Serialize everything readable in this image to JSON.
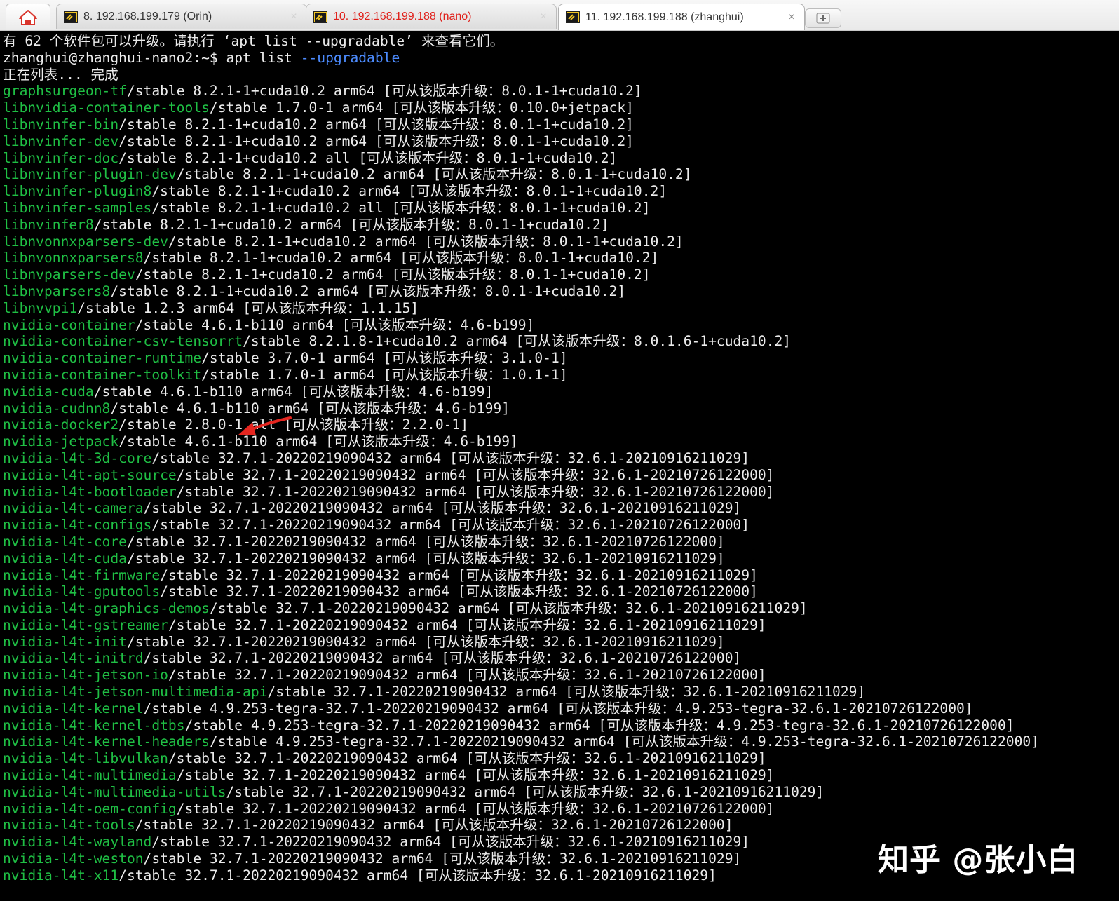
{
  "tabs": {
    "home_icon": "home-icon",
    "items": [
      {
        "label": "8. 192.168.199.179 (Orin)",
        "icon": "terminal-icon",
        "close": "×"
      },
      {
        "label": "10. 192.168.199.188 (nano)",
        "icon": "terminal-icon",
        "close": "×"
      },
      {
        "label": "11. 192.168.199.188 (zhanghui)",
        "icon": "terminal-icon",
        "close": "×"
      }
    ],
    "new_tab_icon": "new-tab-icon"
  },
  "colors": {
    "package_name": "#1fbf44",
    "option_flag": "#4d8cff",
    "text": "#ececec",
    "warning_tab": "#e0201a"
  },
  "terminal": {
    "notice": "有 62 个软件包可以升级。请执行 ‘apt list --upgradable’ 来查看它们。",
    "prompt": "zhanghui@zhanghui-nano2:~$ ",
    "command": "apt list ",
    "command_flag": "--upgradable",
    "listing_status": "正在列表... 完成",
    "packages": [
      {
        "name": "graphsurgeon-tf",
        "rest": "/stable 8.2.1-1+cuda10.2 arm64 [可从该版本升级：8.0.1-1+cuda10.2]"
      },
      {
        "name": "libnvidia-container-tools",
        "rest": "/stable 1.7.0-1 arm64 [可从该版本升级：0.10.0+jetpack]"
      },
      {
        "name": "libnvinfer-bin",
        "rest": "/stable 8.2.1-1+cuda10.2 arm64 [可从该版本升级：8.0.1-1+cuda10.2]"
      },
      {
        "name": "libnvinfer-dev",
        "rest": "/stable 8.2.1-1+cuda10.2 arm64 [可从该版本升级：8.0.1-1+cuda10.2]"
      },
      {
        "name": "libnvinfer-doc",
        "rest": "/stable 8.2.1-1+cuda10.2 all [可从该版本升级：8.0.1-1+cuda10.2]"
      },
      {
        "name": "libnvinfer-plugin-dev",
        "rest": "/stable 8.2.1-1+cuda10.2 arm64 [可从该版本升级：8.0.1-1+cuda10.2]"
      },
      {
        "name": "libnvinfer-plugin8",
        "rest": "/stable 8.2.1-1+cuda10.2 arm64 [可从该版本升级：8.0.1-1+cuda10.2]"
      },
      {
        "name": "libnvinfer-samples",
        "rest": "/stable 8.2.1-1+cuda10.2 all [可从该版本升级：8.0.1-1+cuda10.2]"
      },
      {
        "name": "libnvinfer8",
        "rest": "/stable 8.2.1-1+cuda10.2 arm64 [可从该版本升级：8.0.1-1+cuda10.2]"
      },
      {
        "name": "libnvonnxparsers-dev",
        "rest": "/stable 8.2.1-1+cuda10.2 arm64 [可从该版本升级：8.0.1-1+cuda10.2]"
      },
      {
        "name": "libnvonnxparsers8",
        "rest": "/stable 8.2.1-1+cuda10.2 arm64 [可从该版本升级：8.0.1-1+cuda10.2]"
      },
      {
        "name": "libnvparsers-dev",
        "rest": "/stable 8.2.1-1+cuda10.2 arm64 [可从该版本升级：8.0.1-1+cuda10.2]"
      },
      {
        "name": "libnvparsers8",
        "rest": "/stable 8.2.1-1+cuda10.2 arm64 [可从该版本升级：8.0.1-1+cuda10.2]"
      },
      {
        "name": "libnvvpi1",
        "rest": "/stable 1.2.3 arm64 [可从该版本升级：1.1.15]"
      },
      {
        "name": "nvidia-container",
        "rest": "/stable 4.6.1-b110 arm64 [可从该版本升级：4.6-b199]"
      },
      {
        "name": "nvidia-container-csv-tensorrt",
        "rest": "/stable 8.2.1.8-1+cuda10.2 arm64 [可从该版本升级：8.0.1.6-1+cuda10.2]"
      },
      {
        "name": "nvidia-container-runtime",
        "rest": "/stable 3.7.0-1 arm64 [可从该版本升级：3.1.0-1]"
      },
      {
        "name": "nvidia-container-toolkit",
        "rest": "/stable 1.7.0-1 arm64 [可从该版本升级：1.0.1-1]"
      },
      {
        "name": "nvidia-cuda",
        "rest": "/stable 4.6.1-b110 arm64 [可从该版本升级：4.6-b199]"
      },
      {
        "name": "nvidia-cudnn8",
        "rest": "/stable 4.6.1-b110 arm64 [可从该版本升级：4.6-b199]"
      },
      {
        "name": "nvidia-docker2",
        "rest": "/stable 2.8.0-1 all [可从该版本升级：2.2.0-1]"
      },
      {
        "name": "nvidia-jetpack",
        "rest": "/stable 4.6.1-b110 arm64 [可从该版本升级：4.6-b199]"
      },
      {
        "name": "nvidia-l4t-3d-core",
        "rest": "/stable 32.7.1-20220219090432 arm64 [可从该版本升级：32.6.1-20210916211029]"
      },
      {
        "name": "nvidia-l4t-apt-source",
        "rest": "/stable 32.7.1-20220219090432 arm64 [可从该版本升级：32.6.1-20210726122000]"
      },
      {
        "name": "nvidia-l4t-bootloader",
        "rest": "/stable 32.7.1-20220219090432 arm64 [可从该版本升级：32.6.1-20210726122000]"
      },
      {
        "name": "nvidia-l4t-camera",
        "rest": "/stable 32.7.1-20220219090432 arm64 [可从该版本升级：32.6.1-20210916211029]"
      },
      {
        "name": "nvidia-l4t-configs",
        "rest": "/stable 32.7.1-20220219090432 arm64 [可从该版本升级：32.6.1-20210726122000]"
      },
      {
        "name": "nvidia-l4t-core",
        "rest": "/stable 32.7.1-20220219090432 arm64 [可从该版本升级：32.6.1-20210726122000]"
      },
      {
        "name": "nvidia-l4t-cuda",
        "rest": "/stable 32.7.1-20220219090432 arm64 [可从该版本升级：32.6.1-20210916211029]"
      },
      {
        "name": "nvidia-l4t-firmware",
        "rest": "/stable 32.7.1-20220219090432 arm64 [可从该版本升级：32.6.1-20210916211029]"
      },
      {
        "name": "nvidia-l4t-gputools",
        "rest": "/stable 32.7.1-20220219090432 arm64 [可从该版本升级：32.6.1-20210726122000]"
      },
      {
        "name": "nvidia-l4t-graphics-demos",
        "rest": "/stable 32.7.1-20220219090432 arm64 [可从该版本升级：32.6.1-20210916211029]"
      },
      {
        "name": "nvidia-l4t-gstreamer",
        "rest": "/stable 32.7.1-20220219090432 arm64 [可从该版本升级：32.6.1-20210916211029]"
      },
      {
        "name": "nvidia-l4t-init",
        "rest": "/stable 32.7.1-20220219090432 arm64 [可从该版本升级：32.6.1-20210916211029]"
      },
      {
        "name": "nvidia-l4t-initrd",
        "rest": "/stable 32.7.1-20220219090432 arm64 [可从该版本升级：32.6.1-20210726122000]"
      },
      {
        "name": "nvidia-l4t-jetson-io",
        "rest": "/stable 32.7.1-20220219090432 arm64 [可从该版本升级：32.6.1-20210726122000]"
      },
      {
        "name": "nvidia-l4t-jetson-multimedia-api",
        "rest": "/stable 32.7.1-20220219090432 arm64 [可从该版本升级：32.6.1-20210916211029]"
      },
      {
        "name": "nvidia-l4t-kernel",
        "rest": "/stable 4.9.253-tegra-32.7.1-20220219090432 arm64 [可从该版本升级：4.9.253-tegra-32.6.1-20210726122000]"
      },
      {
        "name": "nvidia-l4t-kernel-dtbs",
        "rest": "/stable 4.9.253-tegra-32.7.1-20220219090432 arm64 [可从该版本升级：4.9.253-tegra-32.6.1-20210726122000]"
      },
      {
        "name": "nvidia-l4t-kernel-headers",
        "rest": "/stable 4.9.253-tegra-32.7.1-20220219090432 arm64 [可从该版本升级：4.9.253-tegra-32.6.1-20210726122000]"
      },
      {
        "name": "nvidia-l4t-libvulkan",
        "rest": "/stable 32.7.1-20220219090432 arm64 [可从该版本升级：32.6.1-20210916211029]"
      },
      {
        "name": "nvidia-l4t-multimedia",
        "rest": "/stable 32.7.1-20220219090432 arm64 [可从该版本升级：32.6.1-20210916211029]"
      },
      {
        "name": "nvidia-l4t-multimedia-utils",
        "rest": "/stable 32.7.1-20220219090432 arm64 [可从该版本升级：32.6.1-20210916211029]"
      },
      {
        "name": "nvidia-l4t-oem-config",
        "rest": "/stable 32.7.1-20220219090432 arm64 [可从该版本升级：32.6.1-20210726122000]"
      },
      {
        "name": "nvidia-l4t-tools",
        "rest": "/stable 32.7.1-20220219090432 arm64 [可从该版本升级：32.6.1-20210726122000]"
      },
      {
        "name": "nvidia-l4t-wayland",
        "rest": "/stable 32.7.1-20220219090432 arm64 [可从该版本升级：32.6.1-20210916211029]"
      },
      {
        "name": "nvidia-l4t-weston",
        "rest": "/stable 32.7.1-20220219090432 arm64 [可从该版本升级：32.6.1-20210916211029]"
      },
      {
        "name": "nvidia-l4t-x11",
        "rest": "/stable 32.7.1-20220219090432 arm64 [可从该版本升级：32.6.1-20210916211029]"
      }
    ]
  },
  "watermark": "知乎 @张小白"
}
